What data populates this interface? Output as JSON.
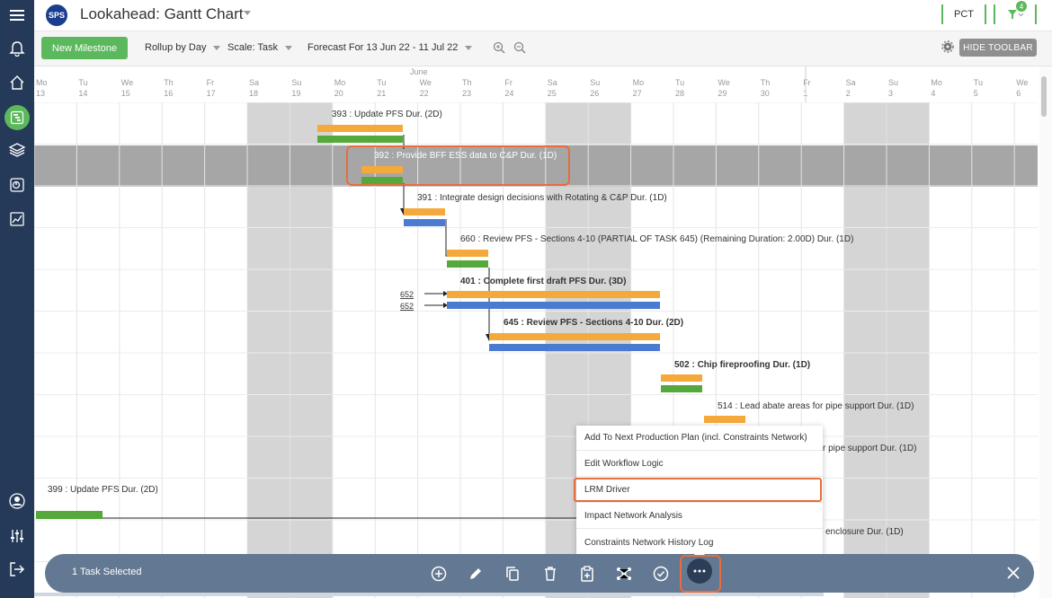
{
  "app": {
    "logo": "SPS",
    "title": "Lookahead: Gantt Chart",
    "pct_label": "PCT",
    "filter_count": "4"
  },
  "toolbar": {
    "new_milestone": "New Milestone",
    "rollup": "Rollup by Day",
    "scale": "Scale: Task",
    "forecast": "Forecast For 13 Jun 22 - 11 Jul 22",
    "hide_toolbar": "HIDE TOOLBAR"
  },
  "timeline": {
    "month": "June",
    "days": [
      {
        "dow": "Mo",
        "num": "13",
        "weekend": false
      },
      {
        "dow": "Tu",
        "num": "14",
        "weekend": false
      },
      {
        "dow": "We",
        "num": "15",
        "weekend": false
      },
      {
        "dow": "Th",
        "num": "16",
        "weekend": false
      },
      {
        "dow": "Fr",
        "num": "17",
        "weekend": false
      },
      {
        "dow": "Sa",
        "num": "18",
        "weekend": true
      },
      {
        "dow": "Su",
        "num": "19",
        "weekend": true
      },
      {
        "dow": "Mo",
        "num": "20",
        "weekend": false
      },
      {
        "dow": "Tu",
        "num": "21",
        "weekend": false
      },
      {
        "dow": "We",
        "num": "22",
        "weekend": false
      },
      {
        "dow": "Th",
        "num": "23",
        "weekend": false
      },
      {
        "dow": "Fr",
        "num": "24",
        "weekend": false
      },
      {
        "dow": "Sa",
        "num": "25",
        "weekend": true
      },
      {
        "dow": "Su",
        "num": "26",
        "weekend": true
      },
      {
        "dow": "Mo",
        "num": "27",
        "weekend": false
      },
      {
        "dow": "Tu",
        "num": "28",
        "weekend": false
      },
      {
        "dow": "We",
        "num": "29",
        "weekend": false
      },
      {
        "dow": "Th",
        "num": "30",
        "weekend": false
      },
      {
        "dow": "Fr",
        "num": "1",
        "weekend": false
      },
      {
        "dow": "Sa",
        "num": "2",
        "weekend": true
      },
      {
        "dow": "Su",
        "num": "3",
        "weekend": true
      },
      {
        "dow": "Mo",
        "num": "4",
        "weekend": false
      },
      {
        "dow": "Tu",
        "num": "5",
        "weekend": false
      },
      {
        "dow": "We",
        "num": "6",
        "weekend": false
      }
    ]
  },
  "tasks": [
    {
      "label": "393 : Update PFS Dur. (2D)",
      "bold": false,
      "selected": false
    },
    {
      "label": "392 : Provide BFF ESS data to C&P Dur. (1D)",
      "bold": false,
      "selected": true
    },
    {
      "label": "391 : Integrate design decisions with Rotating & C&P Dur. (1D)",
      "bold": false,
      "selected": false
    },
    {
      "label": "660 : Review PFS - Sections 4-10 (PARTIAL OF TASK 645) (Remaining Duration: 2.00D) Dur. (1D)",
      "bold": false,
      "selected": false
    },
    {
      "label": "401 : Complete first draft PFS Dur. (3D)",
      "bold": true,
      "selected": false,
      "predecessors": [
        "652",
        "652"
      ]
    },
    {
      "label": "645 : Review PFS - Sections 4-10 Dur. (2D)",
      "bold": true,
      "selected": false
    },
    {
      "label": "502 : Chip fireproofing Dur. (1D)",
      "bold": true,
      "selected": false
    },
    {
      "label": "514 : Lead abate areas for pipe support Dur. (1D)",
      "bold": false,
      "selected": false
    },
    {
      "label": "r pipe support Dur. (1D)",
      "bold": false,
      "selected": false
    },
    {
      "label": "399 : Update PFS Dur. (2D)",
      "bold": false,
      "selected": false
    },
    {
      "label": "enclosure Dur. (1D)",
      "bold": false,
      "selected": false
    }
  ],
  "context_menu": {
    "items": [
      "Add To Next Production Plan (incl. Constraints Network)",
      "Edit Workflow Logic",
      "LRM Driver",
      "Impact Network Analysis",
      "Constraints Network History Log"
    ],
    "highlighted": "LRM Driver"
  },
  "bottom_bar": {
    "selection_text": "1 Task Selected"
  },
  "colors": {
    "nav_bg": "#253a59",
    "accent_green": "#5cb85c",
    "bar_orange": "#f5a93b",
    "bar_green": "#55a83a",
    "bar_blue": "#4a7bd0",
    "weekend": "#d5d5d5",
    "selected_row": "#a6a6a6",
    "highlight": "#e86c3c",
    "bottom_bar": "#637892"
  }
}
